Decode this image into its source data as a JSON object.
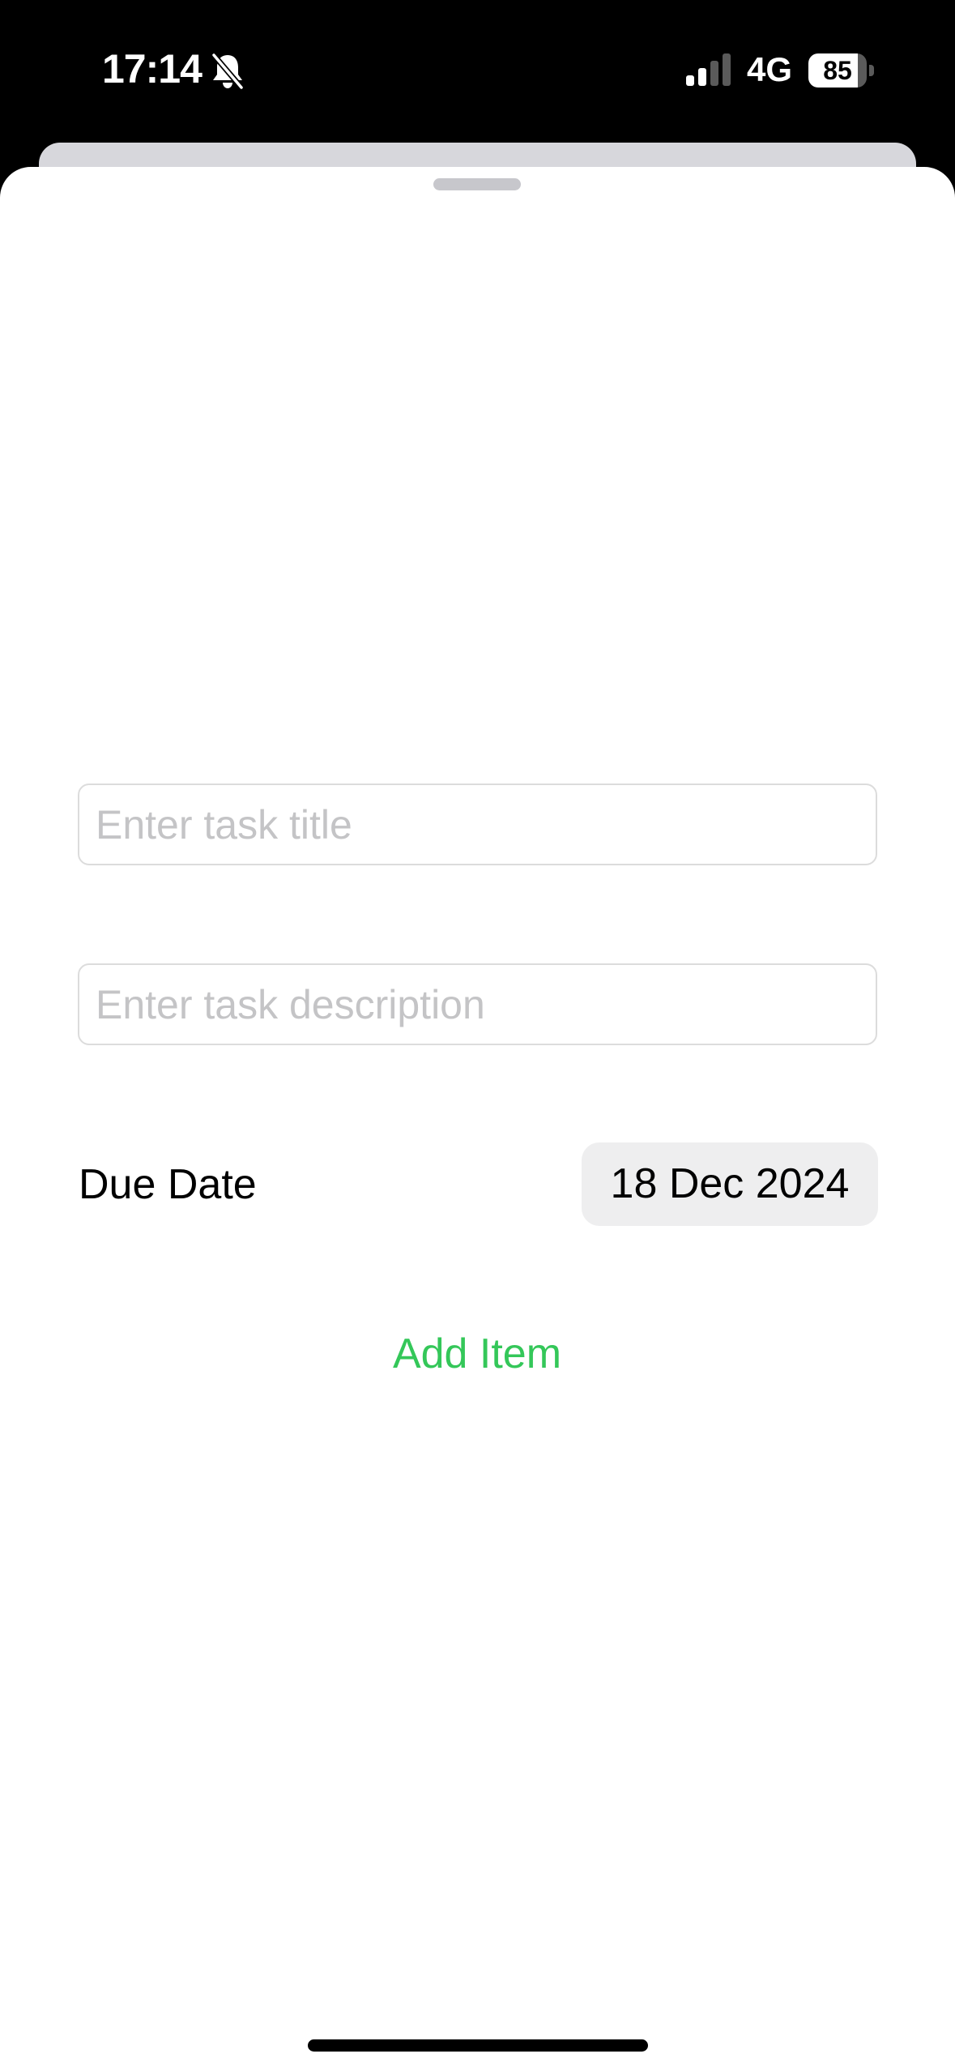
{
  "status_bar": {
    "time": "17:14",
    "network": "4G",
    "battery_level": "85",
    "silent_icon": "bell-slash-icon",
    "signal_icon": "cellular-signal-icon"
  },
  "form": {
    "title_field": {
      "placeholder": "Enter task title",
      "value": ""
    },
    "description_field": {
      "placeholder": "Enter task description",
      "value": ""
    },
    "due_date_label": "Due Date",
    "due_date_value": "18 Dec 2024",
    "add_button_label": "Add Item"
  },
  "colors": {
    "accent": "#34c759",
    "placeholder": "#c4c4c6",
    "date_pill": "#eeeeef"
  }
}
